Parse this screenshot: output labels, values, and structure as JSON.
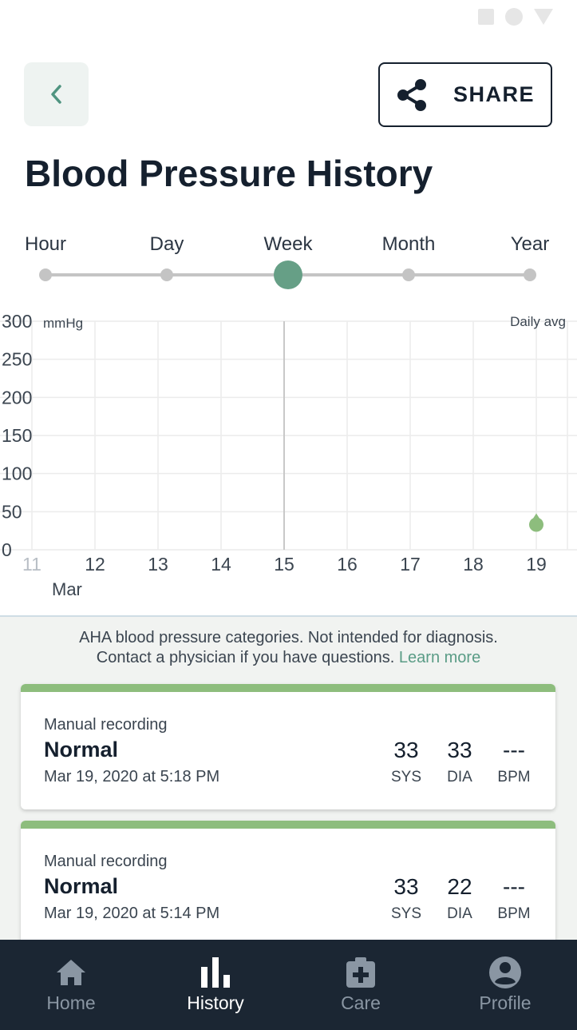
{
  "status_bar": {
    "icons": [
      "square-icon",
      "circle-icon",
      "triangle-icon"
    ]
  },
  "header": {
    "back_icon": "chevron-left-icon",
    "share_label": "SHARE",
    "share_icon": "share-icon",
    "title": "Blood Pressure History"
  },
  "time_range": {
    "options": [
      "Hour",
      "Day",
      "Week",
      "Month",
      "Year"
    ],
    "selected": "Week"
  },
  "chart": {
    "unit": "mmHg",
    "mode_label": "Daily avg",
    "y_ticks": [
      "300",
      "250",
      "200",
      "150",
      "100",
      "50",
      "0"
    ],
    "x_ticks": [
      "11",
      "12",
      "13",
      "14",
      "15",
      "16",
      "17",
      "18",
      "19"
    ],
    "month_label": "Mar"
  },
  "chart_data": {
    "type": "scatter",
    "x": [
      "19"
    ],
    "series": [
      {
        "values": [
          33
        ]
      }
    ],
    "xlabel": "",
    "ylabel": "mmHg",
    "ylim": [
      0,
      300
    ],
    "grid": true,
    "colors": {
      "point": "#8dbd7d",
      "accent": "#669f86"
    }
  },
  "aha": {
    "line1": "AHA blood pressure categories. Not intended for diagnosis.",
    "line2": "Contact a physician if you have questions.",
    "link": "Learn more"
  },
  "readings": [
    {
      "source": "Manual recording",
      "category": "Normal",
      "date": "Mar 19, 2020 at 5:18 PM",
      "sys": "33",
      "dia": "33",
      "bpm": "---",
      "sys_label": "SYS",
      "dia_label": "DIA",
      "bpm_label": "BPM"
    },
    {
      "source": "Manual recording",
      "category": "Normal",
      "date": "Mar 19, 2020 at 5:14 PM",
      "sys": "33",
      "dia": "22",
      "bpm": "---",
      "sys_label": "SYS",
      "dia_label": "DIA",
      "bpm_label": "BPM"
    }
  ],
  "bottom_nav": {
    "items": [
      {
        "label": "Home",
        "icon": "home-icon"
      },
      {
        "label": "History",
        "icon": "history-chart-icon"
      },
      {
        "label": "Care",
        "icon": "care-kit-icon"
      },
      {
        "label": "Profile",
        "icon": "profile-icon"
      }
    ],
    "active": "History"
  },
  "colors": {
    "accent": "#669f86",
    "normal": "#8dbd7d",
    "nav_bg": "#1b2633",
    "text": "#15202e"
  }
}
